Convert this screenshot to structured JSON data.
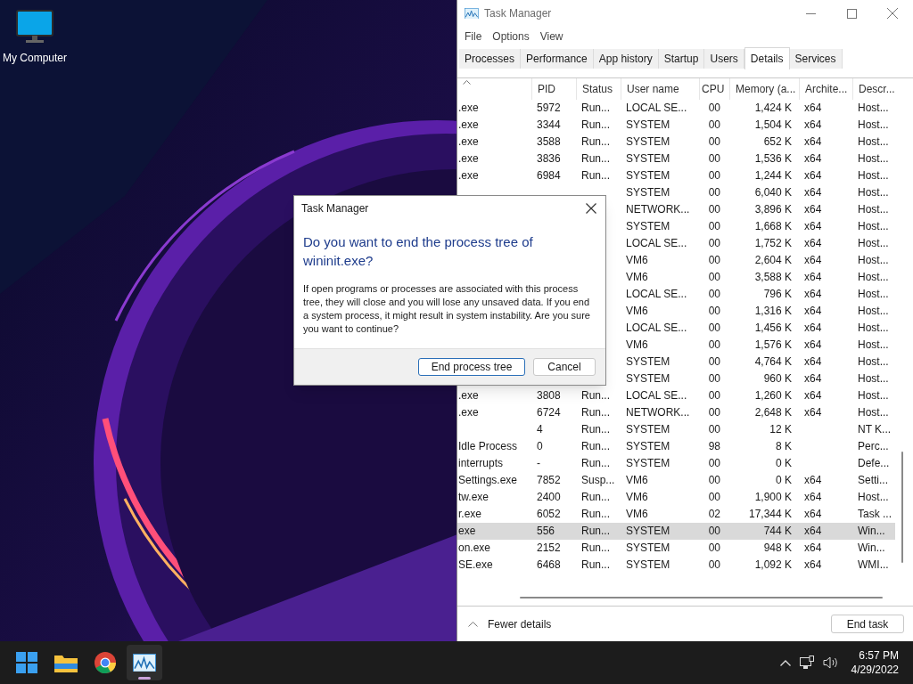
{
  "desktop_icons": [
    {
      "label": "My Computer"
    }
  ],
  "task_manager": {
    "title": "Task Manager",
    "menu": [
      "File",
      "Options",
      "View"
    ],
    "tabs": [
      {
        "label": "Processes",
        "selected": false
      },
      {
        "label": "Performance",
        "selected": false
      },
      {
        "label": "App history",
        "selected": false
      },
      {
        "label": "Startup",
        "selected": false
      },
      {
        "label": "Users",
        "selected": false
      },
      {
        "label": "Details",
        "selected": true
      },
      {
        "label": "Services",
        "selected": false
      }
    ],
    "columns": [
      "",
      "PID",
      "Status",
      "User name",
      "CPU",
      "Memory (a...",
      "Archite...",
      "Descr..."
    ],
    "rows": [
      {
        "name": ".exe",
        "pid": "5972",
        "status": "Run...",
        "user": "LOCAL SE...",
        "cpu": "00",
        "memory": "1,424 K",
        "arch": "x64",
        "description": "Host...",
        "selected": false
      },
      {
        "name": ".exe",
        "pid": "3344",
        "status": "Run...",
        "user": "SYSTEM",
        "cpu": "00",
        "memory": "1,504 K",
        "arch": "x64",
        "description": "Host...",
        "selected": false
      },
      {
        "name": ".exe",
        "pid": "3588",
        "status": "Run...",
        "user": "SYSTEM",
        "cpu": "00",
        "memory": "652 K",
        "arch": "x64",
        "description": "Host...",
        "selected": false
      },
      {
        "name": ".exe",
        "pid": "3836",
        "status": "Run...",
        "user": "SYSTEM",
        "cpu": "00",
        "memory": "1,536 K",
        "arch": "x64",
        "description": "Host...",
        "selected": false
      },
      {
        "name": ".exe",
        "pid": "6984",
        "status": "Run...",
        "user": "SYSTEM",
        "cpu": "00",
        "memory": "1,244 K",
        "arch": "x64",
        "description": "Host...",
        "selected": false
      },
      {
        "user": "SYSTEM",
        "cpu": "00",
        "memory": "6,040 K",
        "arch": "x64",
        "description": "Host...",
        "selected": false
      },
      {
        "user": "NETWORK...",
        "cpu": "00",
        "memory": "3,896 K",
        "arch": "x64",
        "description": "Host...",
        "selected": false
      },
      {
        "user": "SYSTEM",
        "cpu": "00",
        "memory": "1,668 K",
        "arch": "x64",
        "description": "Host...",
        "selected": false
      },
      {
        "user": "LOCAL SE...",
        "cpu": "00",
        "memory": "1,752 K",
        "arch": "x64",
        "description": "Host...",
        "selected": false
      },
      {
        "user": "VM6",
        "cpu": "00",
        "memory": "2,604 K",
        "arch": "x64",
        "description": "Host...",
        "selected": false
      },
      {
        "user": "VM6",
        "cpu": "00",
        "memory": "3,588 K",
        "arch": "x64",
        "description": "Host...",
        "selected": false
      },
      {
        "user": "LOCAL SE...",
        "cpu": "00",
        "memory": "796 K",
        "arch": "x64",
        "description": "Host...",
        "selected": false
      },
      {
        "user": "VM6",
        "cpu": "00",
        "memory": "1,316 K",
        "arch": "x64",
        "description": "Host...",
        "selected": false
      },
      {
        "user": "LOCAL SE...",
        "cpu": "00",
        "memory": "1,456 K",
        "arch": "x64",
        "description": "Host...",
        "selected": false
      },
      {
        "user": "VM6",
        "cpu": "00",
        "memory": "1,576 K",
        "arch": "x64",
        "description": "Host...",
        "selected": false
      },
      {
        "user": "SYSTEM",
        "cpu": "00",
        "memory": "4,764 K",
        "arch": "x64",
        "description": "Host...",
        "selected": false
      },
      {
        "user": "SYSTEM",
        "cpu": "00",
        "memory": "960 K",
        "arch": "x64",
        "description": "Host...",
        "selected": false
      },
      {
        "name": ".exe",
        "pid": "3808",
        "status": "Run...",
        "user": "LOCAL SE...",
        "cpu": "00",
        "memory": "1,260 K",
        "arch": "x64",
        "description": "Host...",
        "selected": false
      },
      {
        "name": ".exe",
        "pid": "6724",
        "status": "Run...",
        "user": "NETWORK...",
        "cpu": "00",
        "memory": "2,648 K",
        "arch": "x64",
        "description": "Host...",
        "selected": false
      },
      {
        "pid": "4",
        "status": "Run...",
        "user": "SYSTEM",
        "cpu": "00",
        "memory": "12 K",
        "description": "NT K...",
        "selected": false
      },
      {
        "name": "Idle Process",
        "pid": "0",
        "status": "Run...",
        "user": "SYSTEM",
        "cpu": "98",
        "memory": "8 K",
        "description": "Perc...",
        "selected": false
      },
      {
        "name": "interrupts",
        "pid": "-",
        "status": "Run...",
        "user": "SYSTEM",
        "cpu": "00",
        "memory": "0 K",
        "description": "Defe...",
        "selected": false
      },
      {
        "name": "Settings.exe",
        "pid": "7852",
        "status": "Susp...",
        "user": "VM6",
        "cpu": "00",
        "memory": "0 K",
        "arch": "x64",
        "description": "Setti...",
        "selected": false
      },
      {
        "name": "tw.exe",
        "pid": "2400",
        "status": "Run...",
        "user": "VM6",
        "cpu": "00",
        "memory": "1,900 K",
        "arch": "x64",
        "description": "Host...",
        "selected": false
      },
      {
        "name": "r.exe",
        "pid": "6052",
        "status": "Run...",
        "user": "VM6",
        "cpu": "02",
        "memory": "17,344 K",
        "arch": "x64",
        "description": "Task ...",
        "selected": false
      },
      {
        "name": "exe",
        "pid": "556",
        "status": "Run...",
        "user": "SYSTEM",
        "cpu": "00",
        "memory": "744 K",
        "arch": "x64",
        "description": "Win...",
        "selected": true
      },
      {
        "name": "on.exe",
        "pid": "2152",
        "status": "Run...",
        "user": "SYSTEM",
        "cpu": "00",
        "memory": "948 K",
        "arch": "x64",
        "description": "Win...",
        "selected": false
      },
      {
        "name": "SE.exe",
        "pid": "6468",
        "status": "Run...",
        "user": "SYSTEM",
        "cpu": "00",
        "memory": "1,092 K",
        "arch": "x64",
        "description": "WMI...",
        "selected": false
      }
    ],
    "footer": {
      "toggle": "Fewer details",
      "button": "End task"
    }
  },
  "dialog": {
    "title": "Task Manager",
    "heading": "Do you want to end the process tree of wininit.exe?",
    "message": "If open programs or processes are associated with this process tree, they will close and you will lose any unsaved data. If you end a system process, it might result in system instability. Are you sure you want to continue?",
    "buttons": [
      {
        "label": "End process tree",
        "default": true
      },
      {
        "label": "Cancel",
        "default": false
      }
    ]
  },
  "taskbar": {
    "apps": [
      {
        "kind": "start",
        "active": false
      },
      {
        "kind": "files",
        "active": false
      },
      {
        "kind": "browser",
        "active": false
      },
      {
        "kind": "taskmanager",
        "active": true
      }
    ],
    "time": "6:57 PM",
    "date": "4/29/2022"
  }
}
